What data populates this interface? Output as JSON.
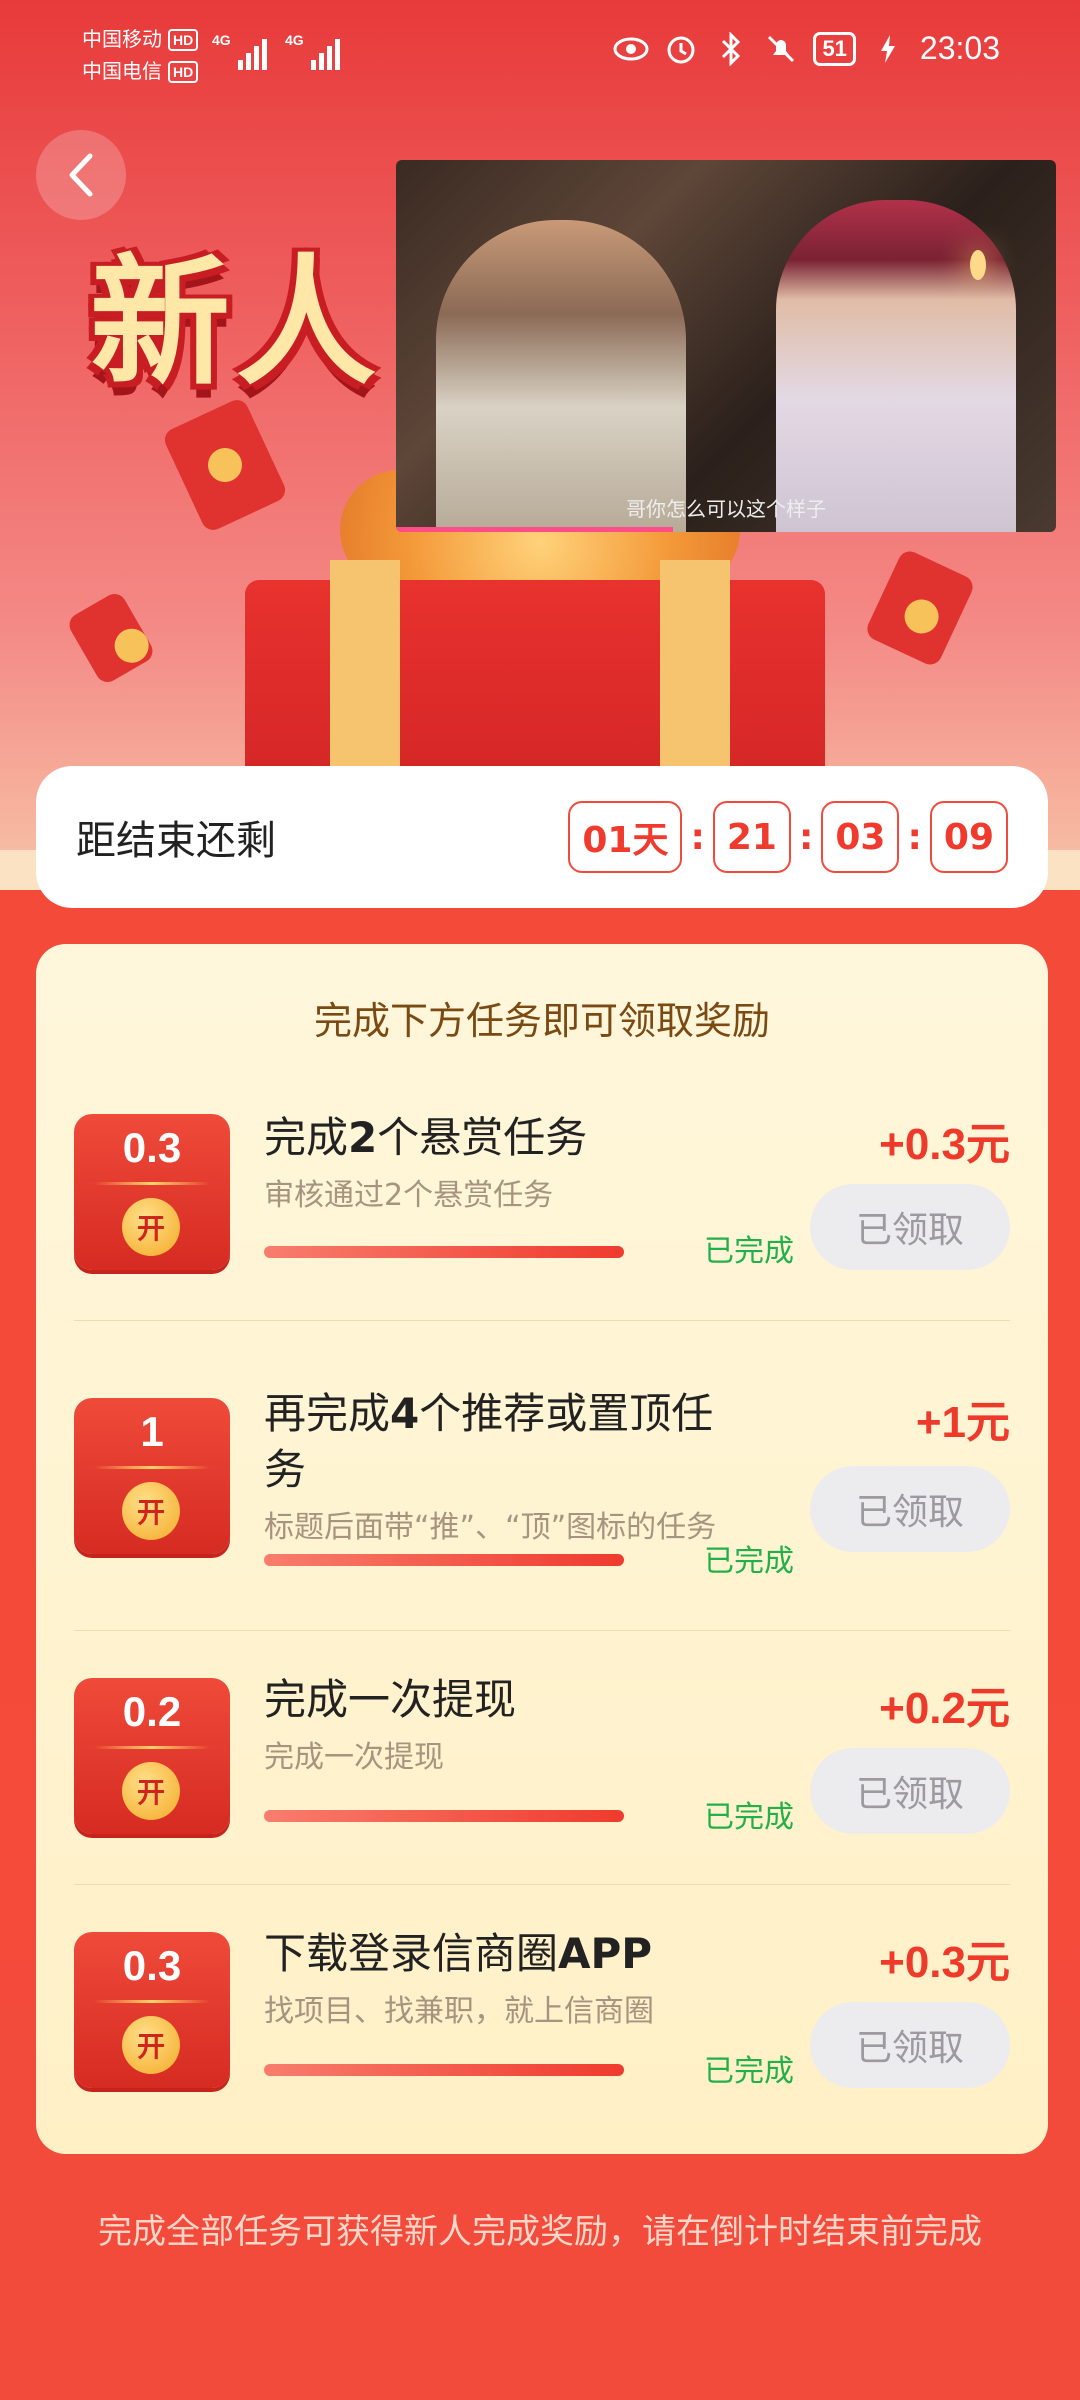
{
  "status_bar": {
    "carrier1": "中国移动",
    "carrier2": "中国电信",
    "hd": "HD",
    "net": "4G",
    "battery": "51",
    "time": "23:03"
  },
  "hero": {
    "title_text": "新人",
    "video_subtitle": "哥你怎么可以这个样子"
  },
  "countdown": {
    "label": "距结束还剩",
    "days": "01天",
    "hours": "21",
    "minutes": "03",
    "seconds": "09",
    "separator": ":"
  },
  "tasks_section": {
    "title": "完成下方任务即可领取奖励",
    "tasks": [
      {
        "tile_amount": "0.3",
        "tile_open": "开",
        "name_pre": "完成",
        "name_bold": "2",
        "name_post": "个悬赏任务",
        "desc": "审核通过2个悬赏任务",
        "status": "已完成",
        "reward": "+0.3元",
        "button": "已领取",
        "progress": 1.0
      },
      {
        "tile_amount": "1",
        "tile_open": "开",
        "name_pre": "再完成",
        "name_bold": "4",
        "name_post": "个推荐或置顶任务",
        "desc": "标题后面带“推”、“顶”图标的任务",
        "status": "已完成",
        "reward": "+1元",
        "button": "已领取",
        "progress": 1.0
      },
      {
        "tile_amount": "0.2",
        "tile_open": "开",
        "name_pre": "完成一次提现",
        "name_bold": "",
        "name_post": "",
        "desc": "完成一次提现",
        "status": "已完成",
        "reward": "+0.2元",
        "button": "已领取",
        "progress": 1.0
      },
      {
        "tile_amount": "0.3",
        "tile_open": "开",
        "name_pre": "下载登录信商圈",
        "name_bold": "APP",
        "name_post": "",
        "desc": "找项目、找兼职，就上信商圈",
        "status": "已完成",
        "reward": "+0.3元",
        "button": "已领取",
        "progress": 1.0
      }
    ]
  },
  "footer_note": "完成全部任务可获得新人完成奖励，请在倒计时结束前完成",
  "colors": {
    "accent_red": "#f03a2e",
    "done_green": "#21b04a",
    "card_cream": "#fff5d6"
  }
}
